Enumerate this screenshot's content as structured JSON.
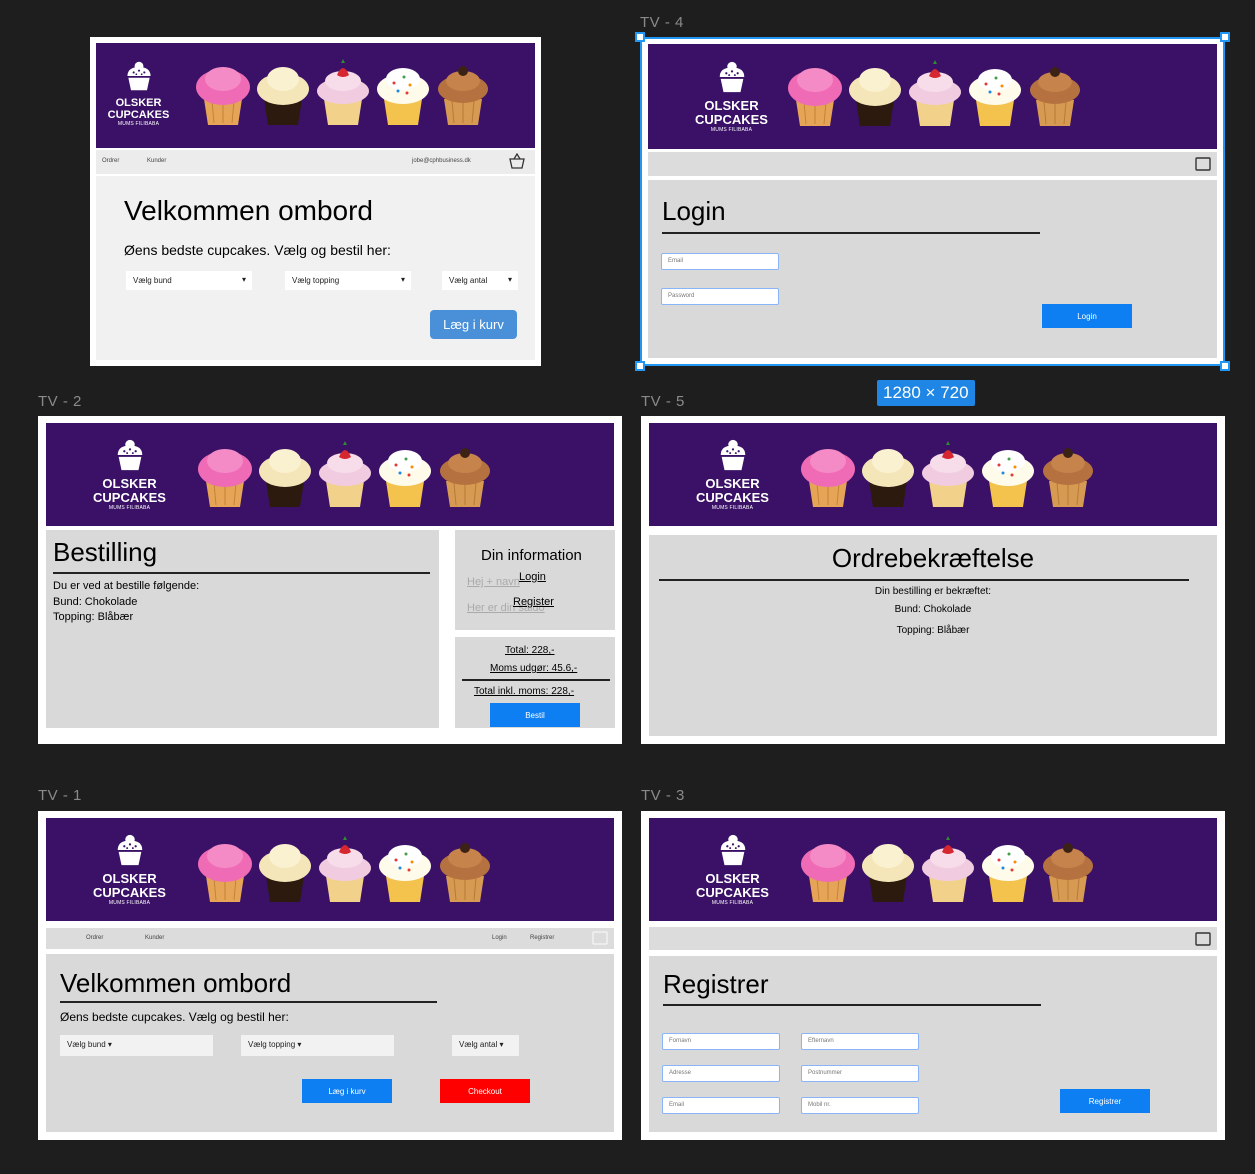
{
  "frames": {
    "welcome": {
      "brand": {
        "line1": "OLSKER",
        "line2": "CUPCAKES",
        "line3": "MUMS FILIBABA"
      },
      "nav": {
        "orders": "Ordrer",
        "customers": "Kunder",
        "email": "jobe@cphbusiness.dk"
      },
      "title": "Velkommen ombord",
      "subtitle": "Øens bedste cupcakes. Vælg og bestil her:",
      "dropdown_bund": "Vælg bund",
      "dropdown_topping": "Vælg topping",
      "dropdown_antal": "Vælg antal",
      "add_button": "Læg i kurv"
    },
    "tv4": {
      "label": "TV - 4",
      "brand": {
        "line1": "OLSKER",
        "line2": "CUPCAKES",
        "line3": "MUMS FILIBABA"
      },
      "title": "Login",
      "email_placeholder": "Email",
      "password_placeholder": "Password",
      "login_button": "Login",
      "size_badge": "1280 × 720"
    },
    "tv2": {
      "label": "TV - 2",
      "brand": {
        "line1": "OLSKER",
        "line2": "CUPCAKES",
        "line3": "MUMS FILIBABA"
      },
      "title": "Bestilling",
      "intro": "Du er ved at bestille følgende:",
      "bund": "Bund: Chokolade",
      "topping": "Topping: Blåbær",
      "info_title": "Din information",
      "ghost1": "Hej + navn",
      "ghost2": "Her er din saldo",
      "login_link": "Login",
      "register_link": "Register",
      "total": "Total: 228,-",
      "moms": "Moms udgør: 45.6,-",
      "total_incl": "Total inkl. moms: 228,-",
      "order_button": "Bestil"
    },
    "tv5": {
      "label": "TV - 5",
      "brand": {
        "line1": "OLSKER",
        "line2": "CUPCAKES",
        "line3": "MUMS FILIBABA"
      },
      "title": "Ordrebekræftelse",
      "confirmed": "Din bestilling er bekræftet:",
      "bund": "Bund: Chokolade",
      "topping": "Topping: Blåbær"
    },
    "tv1": {
      "label": "TV - 1",
      "brand": {
        "line1": "OLSKER",
        "line2": "CUPCAKES",
        "line3": "MUMS FILIBABA"
      },
      "nav": {
        "orders": "Ordrer",
        "customers": "Kunder",
        "login": "Login",
        "register": "Registrer"
      },
      "title": "Velkommen ombord",
      "subtitle": "Øens bedste cupcakes. Vælg og bestil her:",
      "dropdown_bund": "Vælg bund ▾",
      "dropdown_topping": "Vælg topping ▾",
      "dropdown_antal": "Vælg antal ▾",
      "add_button": "Læg i kurv",
      "checkout_button": "Checkout"
    },
    "tv3": {
      "label": "TV - 3",
      "brand": {
        "line1": "OLSKER",
        "line2": "CUPCAKES",
        "line3": "MUMS FILIBABA"
      },
      "title": "Registrer",
      "firstname": "Fornavn",
      "lastname": "Efternavn",
      "address": "Adresse",
      "postal": "Postnummer",
      "email": "Email",
      "phone": "Mobil nr.",
      "register_button": "Registrer"
    }
  },
  "colors": {
    "banner": "#3a1166",
    "panel": "#d9d9d9",
    "button_blue": "#0d7ff2",
    "button_red": "#ff0000",
    "selection": "#2196f3"
  }
}
